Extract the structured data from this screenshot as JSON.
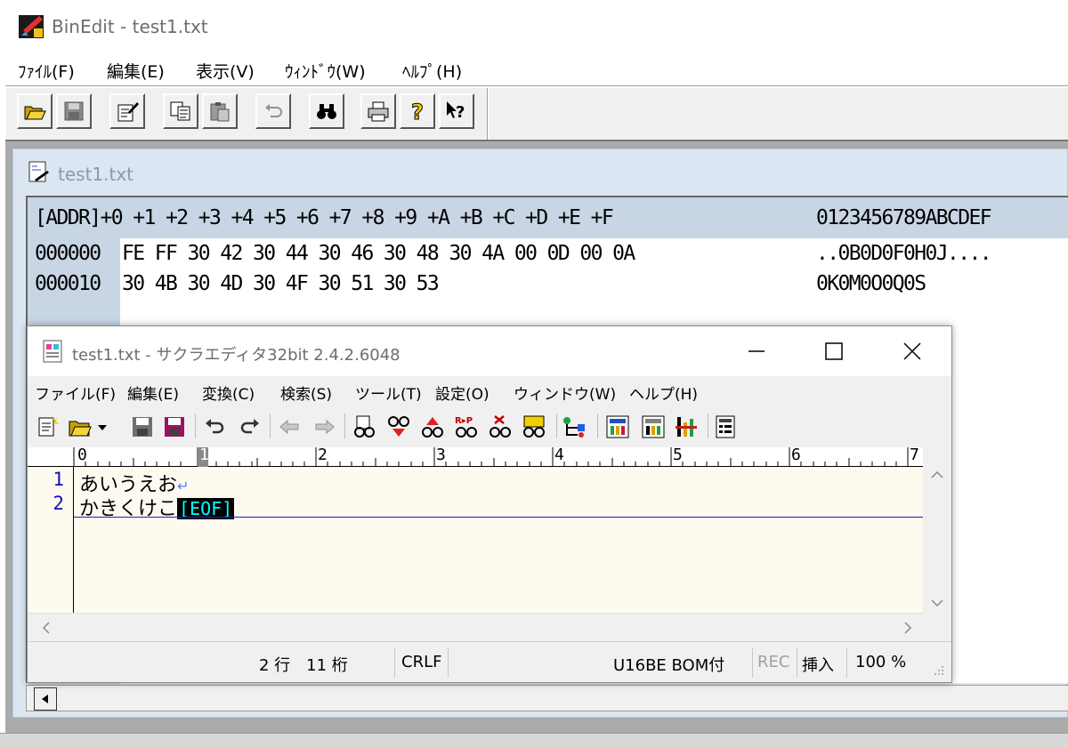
{
  "binedit": {
    "title": "BinEdit - test1.txt",
    "menu": [
      "ﾌｧｲﾙ(F)",
      "編集(E)",
      "表示(V)",
      "ｳｨﾝﾄﾞｳ(W)",
      "ﾍﾙﾌﾟ(H)"
    ],
    "toolbar_icons": [
      "open-folder-icon",
      "save-disk-icon",
      "edit-document-icon",
      "copy-icon",
      "paste-icon",
      "undo-icon",
      "find-binoculars-icon",
      "print-icon",
      "help-icon",
      "context-help-icon"
    ],
    "doc_title": "test1.txt",
    "hex_header": "[ADDR]+0 +1 +2 +3 +4 +5 +6 +7 +8 +9 +A +B +C +D +E +F",
    "ascii_header": "0123456789ABCDEF",
    "rows": [
      {
        "addr": "000000",
        "hex": "FE FF 30 42 30 44 30 46 30 48 30 4A 00 0D 00 0A",
        "ascii": "..0B0D0F0H0J...."
      },
      {
        "addr": "000010",
        "hex": "30 4B 30 4D 30 4F 30 51 30 53",
        "ascii": "0K0M0O0Q0S"
      }
    ]
  },
  "sakura": {
    "title": "test1.txt - サクラエディタ32bit 2.4.2.6048",
    "menu": [
      "ファイル(F)",
      "編集(E)",
      "変換(C)",
      "検索(S)",
      "ツール(T)",
      "設定(O)",
      "ウィンドウ(W)",
      "ヘルプ(H)"
    ],
    "ruler": [
      "0",
      "1",
      "2",
      "3",
      "4",
      "5",
      "6",
      "7"
    ],
    "lines": [
      {
        "num": "1",
        "text": "あいうえお",
        "end": "↵"
      },
      {
        "num": "2",
        "text": "かきくけこ",
        "end": "[EOF]"
      }
    ],
    "status": {
      "position": "2 行　11 桁",
      "line_ending": "CRLF",
      "encoding": "U16BE BOM付",
      "rec": "REC",
      "mode": "挿入",
      "zoom": "100 %"
    }
  }
}
